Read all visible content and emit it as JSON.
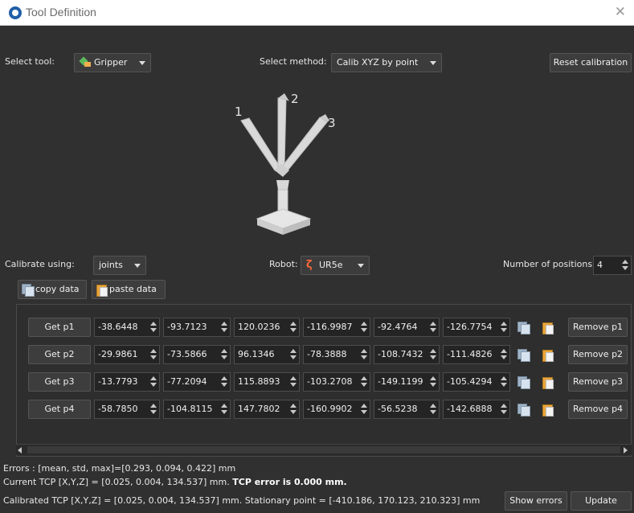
{
  "window": {
    "title": "Tool Definition",
    "close_glyph": "✕"
  },
  "top": {
    "select_tool_label": "Select tool:",
    "tool_value": "Gripper",
    "select_method_label": "Select method:",
    "method_value": "Calib XYZ by point",
    "reset_label": "Reset calibration"
  },
  "diagram": {
    "labels": [
      "1",
      "2",
      "3"
    ]
  },
  "mid": {
    "calibrate_label": "Calibrate using:",
    "calibrate_value": "joints",
    "robot_label": "Robot:",
    "robot_value": "UR5e",
    "positions_label": "Number of positions:",
    "positions_value": "4",
    "copy_label": "copy data",
    "paste_label": "paste data"
  },
  "rows": [
    {
      "get": "Get p1",
      "values": [
        "-38.6448",
        "-93.7123",
        "120.0236",
        "-116.9987",
        "-92.4764",
        "-126.7754"
      ],
      "remove": "Remove p1"
    },
    {
      "get": "Get p2",
      "values": [
        "-29.9861",
        "-73.5866",
        "96.1346",
        "-78.3888",
        "-108.7432",
        "-111.4826"
      ],
      "remove": "Remove p2"
    },
    {
      "get": "Get p3",
      "values": [
        "-13.7793",
        "-77.2094",
        "115.8893",
        "-103.2708",
        "-149.1199",
        "-105.4294"
      ],
      "remove": "Remove p3"
    },
    {
      "get": "Get p4",
      "values": [
        "-58.7850",
        "-104.8115",
        "147.7802",
        "-160.9902",
        "-56.5238",
        "-142.6888"
      ],
      "remove": "Remove p4"
    }
  ],
  "status": {
    "errors": "Errors : [mean, std, max]=[0.293, 0.094, 0.422] mm",
    "current_tcp": "Current TCP [X,Y,Z] = [0.025, 0.004, 134.537] mm.",
    "tcp_error": "TCP error is 0.000 mm.",
    "calibrated_tcp": "Calibrated TCP [X,Y,Z] = [0.025, 0.004, 134.537] mm. Stationary point = [-410.186, 170.123, 210.323] mm",
    "show_errors_label": "Show errors",
    "update_label": "Update"
  }
}
